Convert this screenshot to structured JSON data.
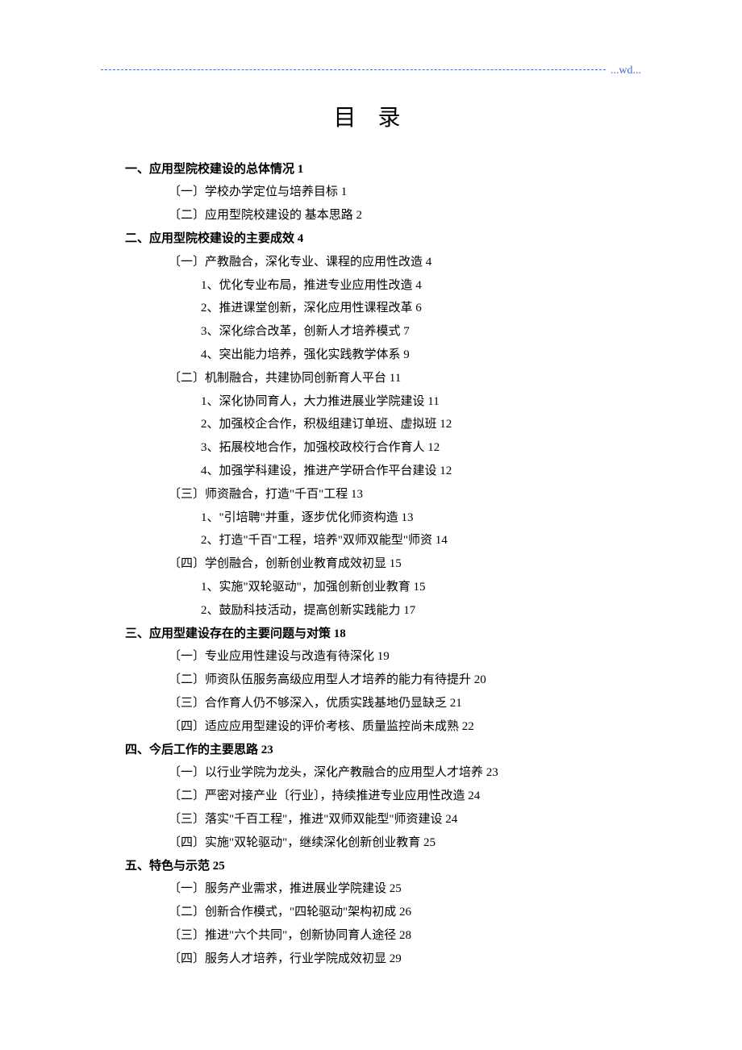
{
  "header_wd": "...wd...",
  "title": "目  录",
  "toc": [
    {
      "level": 1,
      "text": "一、应用型院校建设的总体情况 1"
    },
    {
      "level": 2,
      "text": "〔一〕学校办学定位与培养目标 1"
    },
    {
      "level": 2,
      "text": "〔二〕应用型院校建设的   基本思路 2"
    },
    {
      "level": 1,
      "text": "二、应用型院校建设的主要成效 4"
    },
    {
      "level": 2,
      "text": "〔一〕产教融合，深化专业、课程的应用性改造 4"
    },
    {
      "level": 3,
      "text": "1、优化专业布局，推进专业应用性改造 4"
    },
    {
      "level": 3,
      "text": "2、推进课堂创新，深化应用性课程改革 6"
    },
    {
      "level": 3,
      "text": "3、深化综合改革，创新人才培养模式 7"
    },
    {
      "level": 3,
      "text": "4、突出能力培养，强化实践教学体系 9"
    },
    {
      "level": 2,
      "text": "〔二〕机制融合，共建协同创新育人平台 11"
    },
    {
      "level": 3,
      "text": "1、深化协同育人，大力推进展业学院建设 11"
    },
    {
      "level": 3,
      "text": "2、加强校企合作，积极组建订单班、虚拟班 12"
    },
    {
      "level": 3,
      "text": "3、拓展校地合作，加强校政校行合作育人 12"
    },
    {
      "level": 3,
      "text": "4、加强学科建设，推进产学研合作平台建设 12"
    },
    {
      "level": 2,
      "text": "〔三〕师资融合，打造\"千百\"工程 13"
    },
    {
      "level": 3,
      "text": "1、\"引培聘\"并重，逐步优化师资构造 13"
    },
    {
      "level": 3,
      "text": "2、打造\"千百\"工程，培养\"双师双能型\"师资 14"
    },
    {
      "level": 2,
      "text": "〔四〕学创融合，创新创业教育成效初显 15"
    },
    {
      "level": 3,
      "text": "1、实施\"双轮驱动\"，加强创新创业教育 15"
    },
    {
      "level": 3,
      "text": "2、鼓励科技活动，提高创新实践能力 17"
    },
    {
      "level": 1,
      "text": "三、应用型建设存在的主要问题与对策 18"
    },
    {
      "level": 2,
      "text": "〔一〕专业应用性建设与改造有待深化 19"
    },
    {
      "level": 2,
      "text": "〔二〕师资队伍服务高级应用型人才培养的能力有待提升 20"
    },
    {
      "level": 2,
      "text": "〔三〕合作育人仍不够深入，优质实践基地仍显缺乏 21"
    },
    {
      "level": 2,
      "text": "〔四〕适应应用型建设的评价考核、质量监控尚未成熟 22"
    },
    {
      "level": 1,
      "text": "四、今后工作的主要思路 23"
    },
    {
      "level": 2,
      "text": "〔一〕以行业学院为龙头，深化产教融合的应用型人才培养 23"
    },
    {
      "level": 2,
      "text": "〔二〕严密对接产业〔行业〕，持续推进专业应用性改造 24"
    },
    {
      "level": 2,
      "text": "〔三〕落实\"千百工程\"，推进\"双师双能型\"师资建设 24"
    },
    {
      "level": 2,
      "text": "〔四〕实施\"双轮驱动\"，继续深化创新创业教育 25"
    },
    {
      "level": 1,
      "text": "五、特色与示范 25"
    },
    {
      "level": 2,
      "text": "〔一〕服务产业需求，推进展业学院建设 25"
    },
    {
      "level": 2,
      "text": "〔二〕创新合作模式，\"四轮驱动\"架构初成 26"
    },
    {
      "level": 2,
      "text": "〔三〕推进\"六个共同\"，创新协同育人途径 28"
    },
    {
      "level": 2,
      "text": "〔四〕服务人才培养，行业学院成效初显 29"
    }
  ]
}
